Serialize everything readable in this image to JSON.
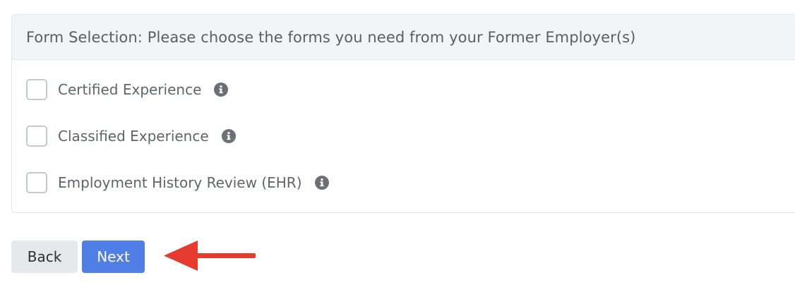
{
  "form_selection": {
    "title": "Form Selection: Please choose the forms you need from your Former Employer(s)",
    "options": [
      {
        "label": "Certified Experience",
        "checked": false,
        "icon": "info-icon"
      },
      {
        "label": "Classified Experience",
        "checked": false,
        "icon": "info-icon"
      },
      {
        "label": "Employment History Review (EHR)",
        "checked": false,
        "icon": "info-icon"
      }
    ]
  },
  "actions": {
    "back_label": "Back",
    "next_label": "Next"
  },
  "annotation": {
    "icon": "arrow-left-icon",
    "color": "#e63b2e"
  },
  "colors": {
    "next_button": "#4f7fe6",
    "back_button": "#e6e8ec",
    "header_bg": "#f3f4f6"
  }
}
